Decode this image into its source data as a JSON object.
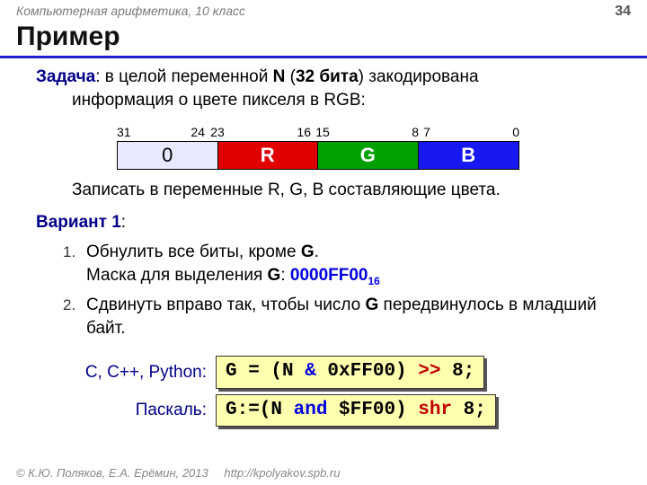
{
  "header": {
    "course": "Компьютерная арифметика, 10 класс",
    "page": "34"
  },
  "title": "Пример",
  "task": {
    "label": "Задача",
    "colon": ":",
    "part1": "  в целой ",
    "part2": "переменной ",
    "var": "N",
    "part3": " (",
    "bits": "32 бита",
    "part4": ") закодирована",
    "line2": "информация о цвете пикселя в RGB:"
  },
  "bit_labels": {
    "l31": "31",
    "l24": "24",
    "l23": "23",
    "l16": "16",
    "l15": "15",
    "l8": "8",
    "l7": "7",
    "l0": "0"
  },
  "cells": {
    "c0": "0",
    "r": "R",
    "g": "G",
    "b": "B"
  },
  "task2": "Записать в переменные R, G, B составляющие цвета.",
  "variant": {
    "label": "Вариант 1",
    "colon": ":"
  },
  "steps": {
    "n1": "1.",
    "s1a": "Обнулить все биты, кроме ",
    "s1g": "G",
    "s1b": ".",
    "s1c": "Маска для выделения ",
    "s1d": ": ",
    "mask": "0000FF00",
    "mask_sub": "16",
    "n2": "2.",
    "s2a": "Сдвинуть вправо так, чтобы число ",
    "s2g": "G",
    "s2b": " передвинулось в младший байт."
  },
  "code": {
    "lang1": "С, С++, Python:",
    "c1a": "G = (N ",
    "c1amp": "&",
    "c1b": " 0xFF00) ",
    "c1sh": ">>",
    "c1c": " 8;",
    "lang2": "Паскаль:",
    "c2a": "G:=(N ",
    "c2and": "and",
    "c2b": " $FF00) ",
    "c2shr": "shr",
    "c2c": " 8;"
  },
  "footer": {
    "copy": "© К.Ю. Поляков, Е.А. Ерёмин, 2013",
    "url": "http://kpolyakov.spb.ru"
  }
}
